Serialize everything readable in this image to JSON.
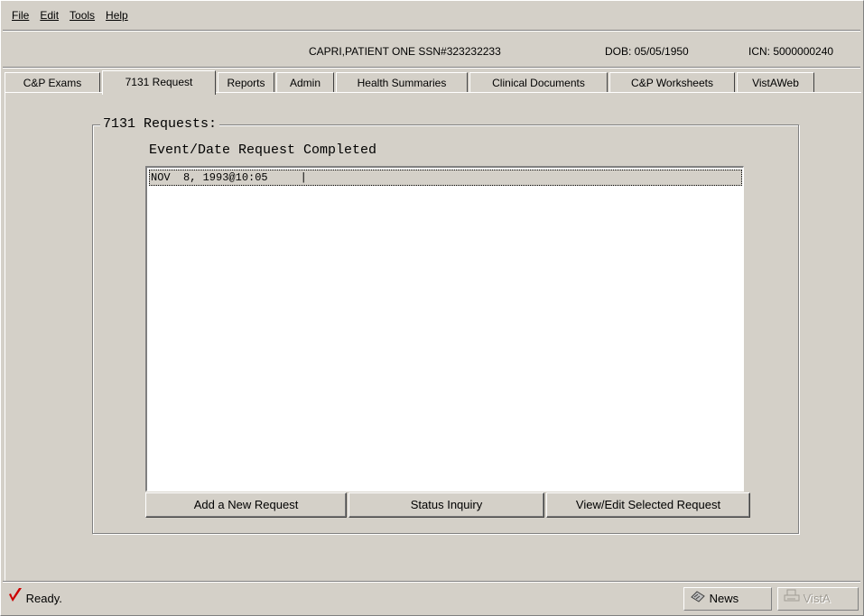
{
  "menu": {
    "file": "File",
    "edit": "Edit",
    "tools": "Tools",
    "help": "Help"
  },
  "patient": {
    "name_ssn": "CAPRI,PATIENT ONE  SSN#323232233",
    "dob": "DOB: 05/05/1950",
    "icn": "ICN: 5000000240"
  },
  "tabs": [
    {
      "label": "C&P Exams"
    },
    {
      "label": "7131 Request"
    },
    {
      "label": "Reports"
    },
    {
      "label": "Admin"
    },
    {
      "label": "Health Summaries"
    },
    {
      "label": "Clinical Documents"
    },
    {
      "label": "C&P Worksheets"
    },
    {
      "label": "VistAWeb"
    }
  ],
  "active_tab": "7131 Request",
  "requests": {
    "group_title": "7131 Requests:",
    "column_header": "Event/Date Request Completed",
    "rows": [
      {
        "text": "NOV  8, 1993@10:05     |"
      }
    ],
    "buttons": {
      "add": "Add a New Request",
      "status": "Status Inquiry",
      "view_edit": "View/Edit Selected Request"
    }
  },
  "status": {
    "text": "Ready.",
    "news": "News",
    "vista": "VistA"
  },
  "colors": {
    "face": "#d4d0c8",
    "status_icon": "#cc0000"
  },
  "icons": [
    "check-mark-icon",
    "news-icon",
    "printer-icon"
  ]
}
